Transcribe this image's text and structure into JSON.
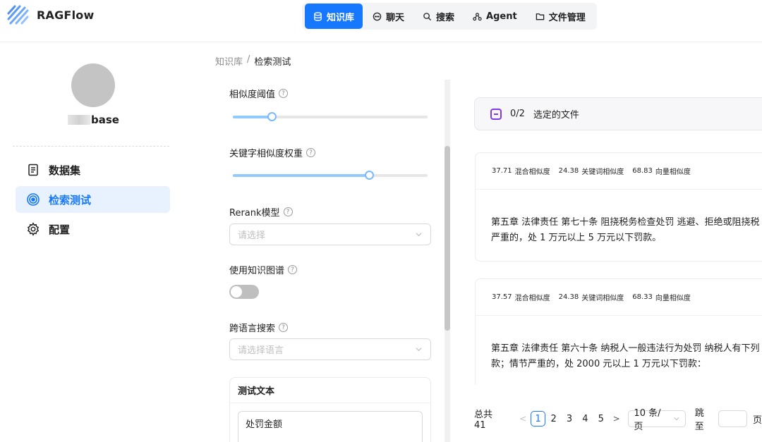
{
  "app": {
    "name": "RAGFlow"
  },
  "nav": {
    "items": [
      {
        "label": "知识库",
        "icon": "database-icon",
        "active": true
      },
      {
        "label": "聊天",
        "icon": "chat-icon",
        "active": false
      },
      {
        "label": "搜索",
        "icon": "search-icon",
        "active": false
      },
      {
        "label": "Agent",
        "icon": "agent-icon",
        "active": false
      },
      {
        "label": "文件管理",
        "icon": "folder-icon",
        "active": false
      }
    ]
  },
  "sidebar": {
    "kb_name": "base",
    "items": [
      {
        "label": "数据集",
        "icon": "document-icon",
        "active": false
      },
      {
        "label": "检索测试",
        "icon": "target-icon",
        "active": true
      },
      {
        "label": "配置",
        "icon": "gear-icon",
        "active": false
      }
    ]
  },
  "breadcrumb": {
    "root": "知识库",
    "separator": "/",
    "current": "检索测试"
  },
  "settings": {
    "similarity_threshold": {
      "label": "相似度阈值",
      "value": 0.2
    },
    "keyword_weight": {
      "label": "关键字相似度权重",
      "value": 0.7
    },
    "rerank": {
      "label": "Rerank模型",
      "placeholder": "请选择"
    },
    "knowledge_graph": {
      "label": "使用知识图谱",
      "enabled": false
    },
    "cross_language": {
      "label": "跨语言搜索",
      "placeholder": "请选择语言"
    },
    "test_text": {
      "label": "测试文本",
      "value": "处罚金额"
    }
  },
  "files": {
    "count": "0/2",
    "label": "选定的文件"
  },
  "results": [
    {
      "hybrid_score": "37.71",
      "hybrid_label": "混合相似度",
      "keyword_score": "24.38",
      "keyword_label": "关键词相似度",
      "vector_score": "68.83",
      "vector_label": "向量相似度",
      "line1": "第五章 法律责任 第七十条 阻挠税务检查处罚 逃避、拒绝或阻挠税",
      "line2": "严重的，处 1 万元以上 5 万元以下罚款。"
    },
    {
      "hybrid_score": "37.57",
      "hybrid_label": "混合相似度",
      "keyword_score": "24.38",
      "keyword_label": "关键词相似度",
      "vector_score": "68.33",
      "vector_label": "向量相似度",
      "line1": "第五章 法律责任 第六十条 纳税人一般违法行为处罚 纳税人有下列",
      "line2": "款；情节严重的，处 2000 元以上 1 万元以下罚款："
    }
  ],
  "pagination": {
    "total": "总共 41",
    "prev": "<",
    "pages": [
      "1",
      "2",
      "3",
      "4",
      "5"
    ],
    "current": 1,
    "next": ">",
    "page_size": "10 条/页",
    "jump_label": "跳至",
    "page_unit": "页"
  },
  "colors": {
    "primary": "#1677ff",
    "accent_purple": "#7c3aed"
  }
}
